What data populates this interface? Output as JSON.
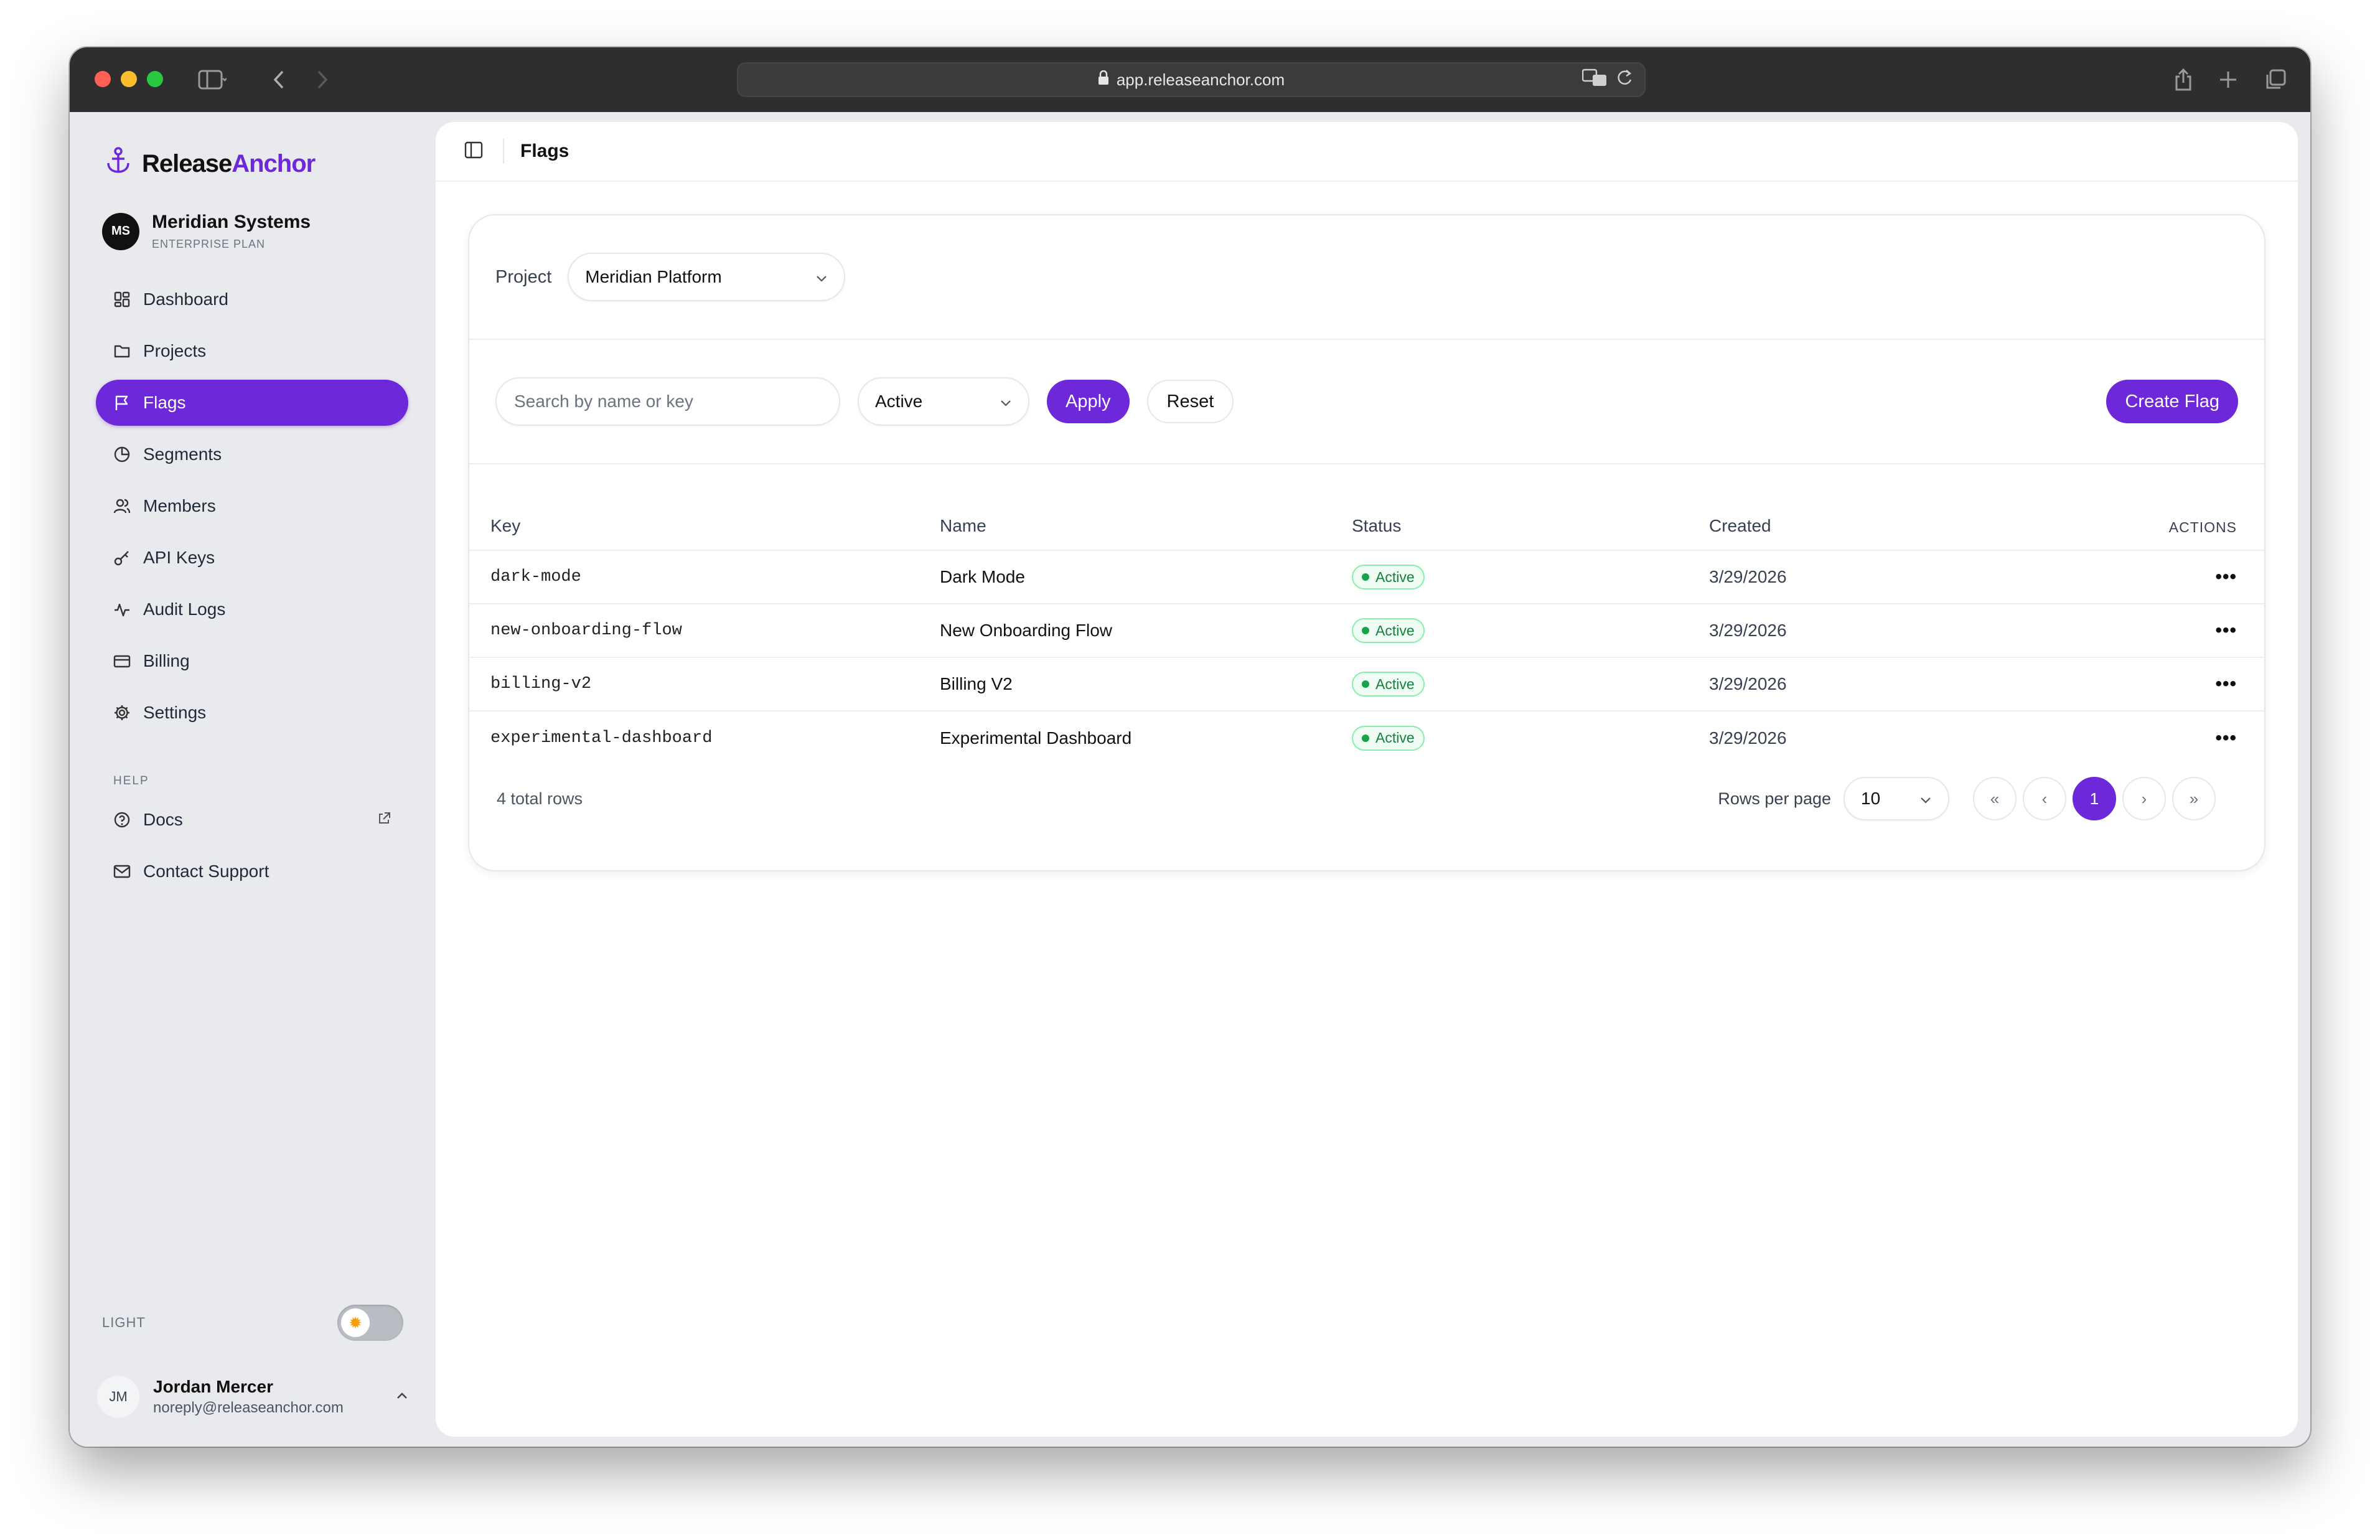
{
  "browser": {
    "url": "app.releaseanchor.com"
  },
  "brand": {
    "name_part1": "Release",
    "name_part2": "Anchor",
    "accent": "#6d28d9"
  },
  "org": {
    "initials": "MS",
    "name": "Meridian Systems",
    "plan": "ENTERPRISE PLAN"
  },
  "nav": {
    "items": [
      {
        "label": "Dashboard",
        "icon": "dashboard-icon"
      },
      {
        "label": "Projects",
        "icon": "folder-icon"
      },
      {
        "label": "Flags",
        "icon": "flag-icon",
        "active": true
      },
      {
        "label": "Segments",
        "icon": "pie-chart-icon"
      },
      {
        "label": "Members",
        "icon": "users-icon"
      },
      {
        "label": "API Keys",
        "icon": "key-icon"
      },
      {
        "label": "Audit Logs",
        "icon": "activity-icon"
      },
      {
        "label": "Billing",
        "icon": "credit-card-icon"
      },
      {
        "label": "Settings",
        "icon": "gear-icon"
      }
    ],
    "help_label": "HELP",
    "help_items": [
      {
        "label": "Docs",
        "icon": "help-circle-icon"
      },
      {
        "label": "Contact Support",
        "icon": "mail-icon"
      }
    ]
  },
  "theme": {
    "label": "LIGHT"
  },
  "user": {
    "initials": "JM",
    "name": "Jordan Mercer",
    "email": "noreply@releaseanchor.com"
  },
  "page": {
    "breadcrumb": "Flags"
  },
  "filters": {
    "project_label": "Project",
    "project_value": "Meridian Platform",
    "search_placeholder": "Search by name or key",
    "status_value": "Active",
    "apply_label": "Apply",
    "reset_label": "Reset",
    "create_label": "Create Flag"
  },
  "table": {
    "headers": {
      "key": "Key",
      "name": "Name",
      "status": "Status",
      "created": "Created",
      "actions": "ACTIONS"
    },
    "rows": [
      {
        "key": "dark-mode",
        "name": "Dark Mode",
        "status": "Active",
        "created": "3/29/2026"
      },
      {
        "key": "new-onboarding-flow",
        "name": "New Onboarding Flow",
        "status": "Active",
        "created": "3/29/2026"
      },
      {
        "key": "billing-v2",
        "name": "Billing V2",
        "status": "Active",
        "created": "3/29/2026"
      },
      {
        "key": "experimental-dashboard",
        "name": "Experimental Dashboard",
        "status": "Active",
        "created": "3/29/2026"
      }
    ],
    "actions_glyph": "•••"
  },
  "pagination": {
    "total_rows": "4 total rows",
    "rows_per_page_label": "Rows per page",
    "rows_per_page_value": "10",
    "first": "«",
    "prev": "‹",
    "current": "1",
    "next": "›",
    "last": "»"
  }
}
